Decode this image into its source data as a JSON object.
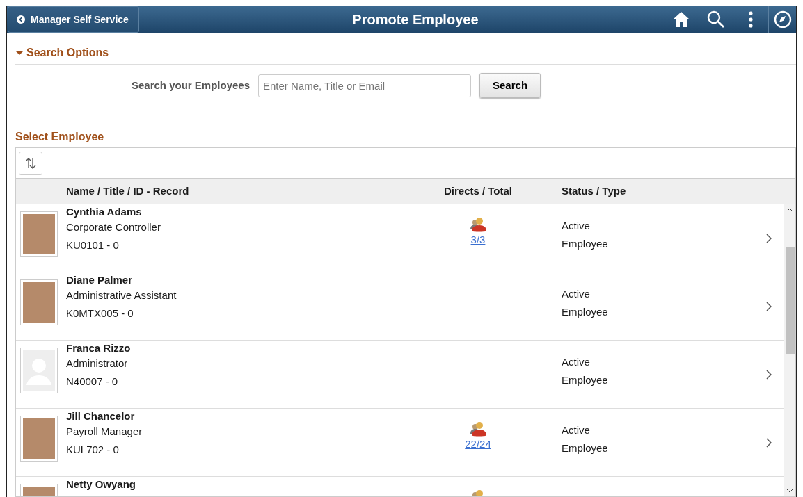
{
  "header": {
    "back_label": "Manager Self Service",
    "title": "Promote Employee"
  },
  "search_options": {
    "title": "Search Options",
    "expanded": true,
    "label": "Search your Employees",
    "placeholder": "Enter Name, Title or Email",
    "button": "Search"
  },
  "employees": {
    "title": "Select Employee",
    "columns": [
      "Name / Title / ID - Record",
      "Directs / Total",
      "Status / Type"
    ],
    "rows": [
      {
        "kind": "photo",
        "name": "Cynthia Adams",
        "title": "Corporate Controller",
        "id": "KU0101 - 0",
        "directs_icon": true,
        "directs": "3/3",
        "status": "Active",
        "type": "Employee"
      },
      {
        "kind": "photo",
        "name": "Diane Palmer",
        "title": "Administrative Assistant",
        "id": "K0MTX005 - 0",
        "directs_icon": false,
        "status": "Active",
        "type": "Employee"
      },
      {
        "kind": "placeholder",
        "name": "Franca Rizzo",
        "title": "Administrator",
        "id": "N40007 - 0",
        "directs_icon": false,
        "status": "Active",
        "type": "Employee"
      },
      {
        "kind": "photo",
        "name": "Jill Chancelor",
        "title": "Payroll Manager",
        "id": "KUL702 - 0",
        "directs_icon": true,
        "directs": "22/24",
        "status": "Active",
        "type": "Employee"
      },
      {
        "kind": "photo",
        "name": "Netty Owyang",
        "directs_icon": true
      }
    ]
  }
}
